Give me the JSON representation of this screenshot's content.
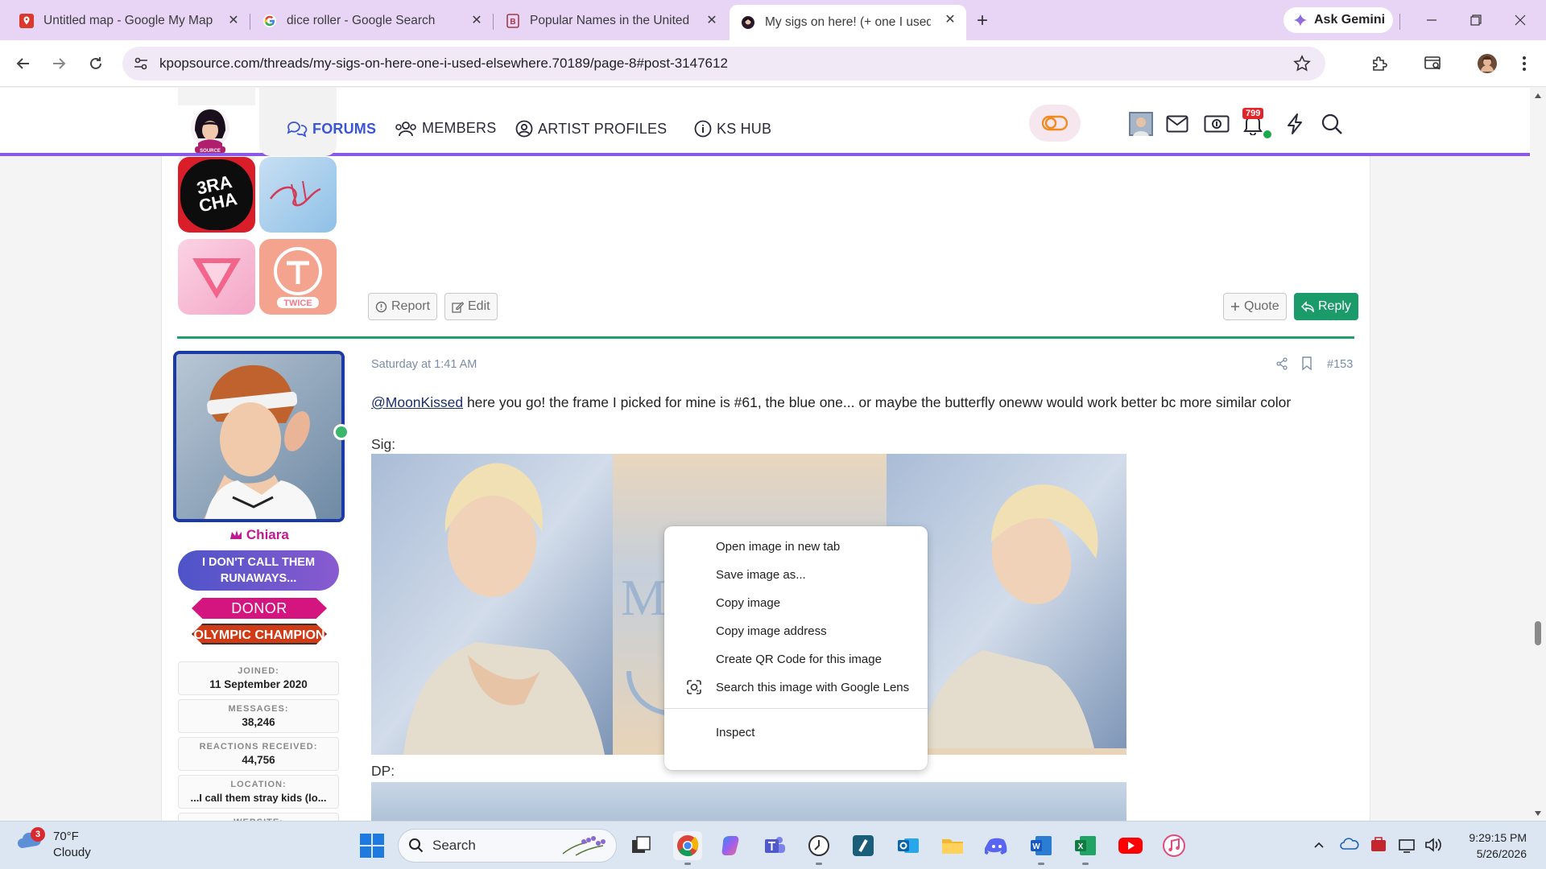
{
  "browser": {
    "tabs": [
      {
        "title": "Untitled map - Google My Maps",
        "favicon": "google-maps-icon"
      },
      {
        "title": "dice roller - Google Search",
        "favicon": "google-icon"
      },
      {
        "title": "Popular Names in the United States",
        "favicon": "bookmark-b-icon"
      },
      {
        "title": "My sigs on here! (+ one I used elsewhere)",
        "favicon": "kpopsource-icon",
        "active": true
      }
    ],
    "gemini_label": "Ask Gemini",
    "url": "kpopsource.com/threads/my-sigs-on-here-one-i-used-elsewhere.70189/page-8#post-3147612"
  },
  "site": {
    "nav": [
      {
        "label": "FORUMS",
        "active": true
      },
      {
        "label": "MEMBERS"
      },
      {
        "label": "ARTIST PROFILES"
      },
      {
        "label": "KS HUB"
      }
    ],
    "alert_count": "799"
  },
  "prev_post": {
    "actions": {
      "report": "Report",
      "edit": "Edit",
      "quote": "Quote",
      "reply": "Reply"
    }
  },
  "post": {
    "user": {
      "name": "Chiara",
      "title": "I DON'T CALL THEM RUNAWAYS...",
      "banners": [
        "DONOR",
        "OLYMPIC CHAMPION"
      ],
      "stats": [
        {
          "key": "JOINED:",
          "value": "11 September 2020"
        },
        {
          "key": "MESSAGES:",
          "value": "38,246"
        },
        {
          "key": "REACTIONS RECEIVED:",
          "value": "44,756"
        },
        {
          "key": "LOCATION:",
          "value": "...I call them stray kids (lo..."
        },
        {
          "key": "WEBSITE:",
          "value": ""
        }
      ]
    },
    "date": "Saturday at 1:41 AM",
    "number": "#153",
    "mention": "@MoonKissed",
    "text": " here you go! the frame I picked for mine is #61, the blue one... or maybe the butterfly oneww would work better bc more similar color",
    "sig_label": "Sig:",
    "dp_label": "DP:"
  },
  "context_menu": {
    "items": [
      "Open image in new tab",
      "Save image as...",
      "Copy image",
      "Copy image address",
      "Create QR Code for this image",
      "Search this image with Google Lens"
    ],
    "inspect": "Inspect"
  },
  "taskbar": {
    "weather": {
      "temp": "70°F",
      "condition": "Cloudy",
      "badge": "3"
    },
    "search_label": "Search",
    "time": "9:29:15 PM",
    "date": "5/26/2026"
  },
  "colors": {
    "accent_purple": "#8b58e8",
    "reply_green": "#1b9a6a",
    "username_pink": "#c11990"
  }
}
